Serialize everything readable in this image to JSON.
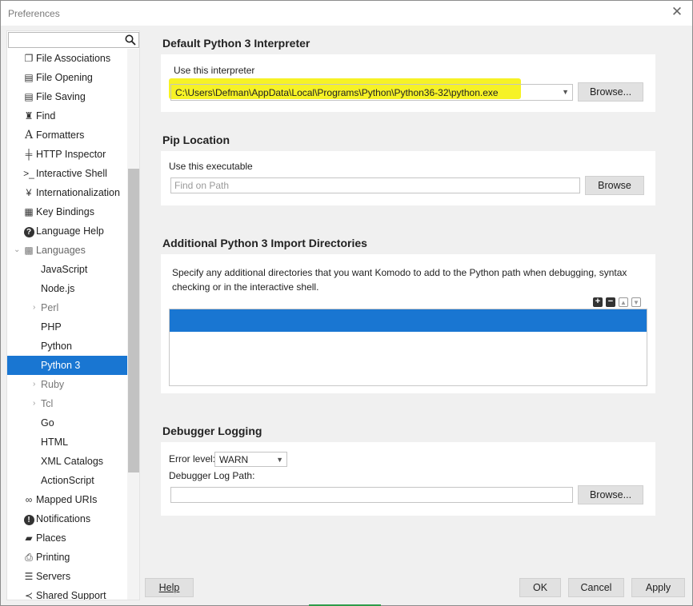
{
  "window": {
    "title": "Preferences"
  },
  "sidebar": {
    "search_placeholder": "",
    "items": [
      {
        "label": "File Associations",
        "icon": "file-associations-icon"
      },
      {
        "label": "File Opening",
        "icon": "file-icon"
      },
      {
        "label": "File Saving",
        "icon": "save-icon"
      },
      {
        "label": "Find",
        "icon": "binoculars-icon"
      },
      {
        "label": "Formatters",
        "icon": "font-icon"
      },
      {
        "label": "HTTP Inspector",
        "icon": "inspector-icon"
      },
      {
        "label": "Interactive Shell",
        "icon": "terminal-icon"
      },
      {
        "label": "Internationalization",
        "icon": "yen-icon"
      },
      {
        "label": "Key Bindings",
        "icon": "keyboard-icon"
      },
      {
        "label": "Language Help",
        "icon": "help-icon"
      },
      {
        "label": "Languages",
        "icon": "languages-icon"
      },
      {
        "label": "JavaScript"
      },
      {
        "label": "Node.js"
      },
      {
        "label": "Perl"
      },
      {
        "label": "PHP"
      },
      {
        "label": "Python"
      },
      {
        "label": "Python 3"
      },
      {
        "label": "Ruby"
      },
      {
        "label": "Tcl"
      },
      {
        "label": "Go"
      },
      {
        "label": "HTML"
      },
      {
        "label": "XML Catalogs"
      },
      {
        "label": "ActionScript"
      },
      {
        "label": "Mapped URIs",
        "icon": "link-icon"
      },
      {
        "label": "Notifications",
        "icon": "info-icon"
      },
      {
        "label": "Places",
        "icon": "folder-icon"
      },
      {
        "label": "Printing",
        "icon": "printer-icon"
      },
      {
        "label": "Servers",
        "icon": "server-icon"
      },
      {
        "label": "Shared Support",
        "icon": "share-icon"
      }
    ]
  },
  "interpreter": {
    "title": "Default Python 3 Interpreter",
    "label": "Use this interpreter",
    "value": "C:\\Users\\Defman\\AppData\\Local\\Programs\\Python\\Python36-32\\python.exe",
    "browse": "Browse...",
    "highlight_color": "#f6f226"
  },
  "pip": {
    "title": "Pip Location",
    "label": "Use this executable",
    "placeholder": "Find on Path",
    "browse": "Browse"
  },
  "import_dirs": {
    "title": "Additional Python 3 Import Directories",
    "description": "Specify any additional directories that you want Komodo to add to the Python path when debugging, syntax checking or in the interactive shell.",
    "tools": [
      "+",
      "−",
      "▲",
      "▼"
    ]
  },
  "debugger": {
    "title": "Debugger Logging",
    "error_level_label": "Error level:",
    "error_level_value": "WARN",
    "log_path_label": "Debugger Log Path:",
    "log_path_value": "",
    "browse": "Browse..."
  },
  "footer": {
    "help": "Help",
    "ok": "OK",
    "cancel": "Cancel",
    "apply": "Apply"
  },
  "colors": {
    "accent": "#1976d2",
    "background": "#f0f0f0"
  }
}
